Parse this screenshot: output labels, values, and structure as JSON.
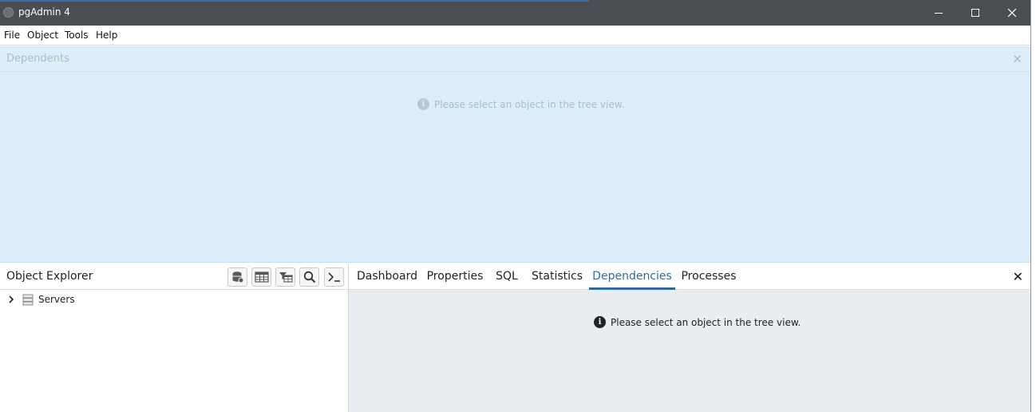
{
  "window": {
    "title": "pgAdmin 4",
    "controls": [
      "minimize",
      "maximize",
      "close"
    ]
  },
  "menu": {
    "items": [
      "File",
      "Object",
      "Tools",
      "Help"
    ]
  },
  "floating_panel": {
    "title": "Dependents",
    "message": "Please select an object in the tree view."
  },
  "explorer": {
    "title": "Object Explorer",
    "toolbar": [
      "database-icon",
      "table-icon",
      "filter-table-icon",
      "search-icon",
      "terminal-icon"
    ],
    "tree": [
      {
        "label": "Servers",
        "expanded": false
      }
    ]
  },
  "main": {
    "tabs": [
      "Dashboard",
      "Properties",
      "SQL",
      "Statistics",
      "Dependencies",
      "Processes"
    ],
    "active_tab": "Dependencies",
    "message": "Please select an object in the tree view."
  },
  "colors": {
    "titlebar": "#4a4d52",
    "accent": "#2c6ca3",
    "floating_panel_bg": "#dbeef9",
    "content_bg": "#e9ecf0"
  }
}
